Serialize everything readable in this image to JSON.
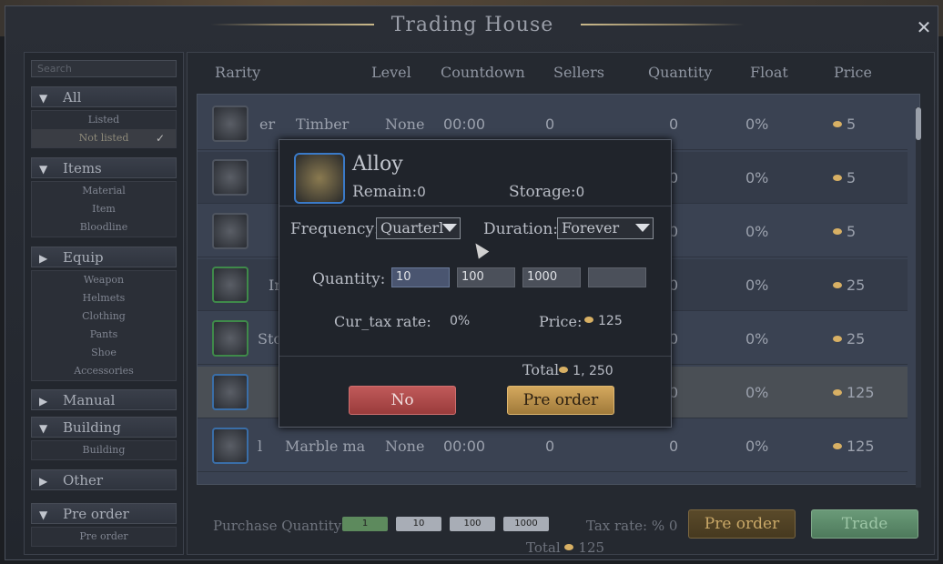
{
  "window": {
    "title": "Trading House"
  },
  "sidebar": {
    "search_placeholder": "Search",
    "categories": [
      {
        "label": "All",
        "sub": [
          "Listed",
          "Not listed"
        ]
      },
      {
        "label": "Items",
        "sub": [
          "Material",
          "Item",
          "Bloodline"
        ]
      },
      {
        "label": "Equip",
        "sub": [
          "Weapon",
          "Helmets",
          "Clothing",
          "Pants",
          "Shoe",
          "Accessories"
        ]
      },
      {
        "label": "Manual",
        "sub": []
      },
      {
        "label": "Building",
        "sub": [
          "Building"
        ]
      },
      {
        "label": "Other",
        "sub": []
      },
      {
        "label": "Pre order",
        "sub": [
          "Pre order"
        ]
      }
    ],
    "selected_sub": "Not listed"
  },
  "table": {
    "headers": [
      "Rarity",
      "Level",
      "Countdown",
      "Sellers",
      "Quantity",
      "Float",
      "Price"
    ],
    "rows": [
      {
        "name_prefix": "er",
        "name": "Timber",
        "level": "None",
        "countdown": "00:00",
        "sellers": "0",
        "quantity": "0",
        "float": "0%",
        "price": "5"
      },
      {
        "name_prefix": "",
        "name": "",
        "level": "",
        "countdown": "",
        "sellers": "",
        "quantity": "0",
        "float": "0%",
        "price": "5"
      },
      {
        "name_prefix": "",
        "name": "",
        "level": "",
        "countdown": "",
        "sellers": "",
        "quantity": "0",
        "float": "0%",
        "price": "5"
      },
      {
        "name_prefix": "Ir",
        "name": "",
        "level": "",
        "countdown": "",
        "sellers": "",
        "quantity": "0",
        "float": "0%",
        "price": "25"
      },
      {
        "name_prefix": "Stor",
        "name": "",
        "level": "",
        "countdown": "",
        "sellers": "",
        "quantity": "0",
        "float": "0%",
        "price": "25"
      },
      {
        "name_prefix": "",
        "name": "",
        "level": "",
        "countdown": "",
        "sellers": "",
        "quantity": "0",
        "float": "0%",
        "price": "125"
      },
      {
        "name_prefix": "l",
        "name": "Marble ma",
        "level": "None",
        "countdown": "00:00",
        "sellers": "0",
        "quantity": "0",
        "float": "0%",
        "price": "125"
      }
    ]
  },
  "bottom": {
    "purchase_quantity_label": "Purchase Quantity",
    "qty_buttons": [
      "1",
      "10",
      "100",
      "1000"
    ],
    "tax_rate": "Tax rate: % 0",
    "total_label": "Total",
    "total_value": "125",
    "preorder_label": "Pre order",
    "trade_label": "Trade"
  },
  "dialog": {
    "item_name": "Alloy",
    "remain_label": "Remain",
    "remain_value": "0",
    "storage_label": "Storage",
    "storage_value": "0",
    "frequency_label": "Frequency:",
    "frequency_value": "Quarterl",
    "duration_label": "Duration:",
    "duration_value": "Forever",
    "quantity_label": "Quantity:",
    "quantity_options": [
      "10",
      "100",
      "1000",
      ""
    ],
    "cur_tax_label": "Cur_tax rate:",
    "cur_tax_value": "0%",
    "price_label": "Price:",
    "price_value": "125",
    "total_label": "Total",
    "total_value": "1, 250",
    "no_label": "No",
    "preorder_label": "Pre order"
  },
  "colors": {
    "no_button": "#b54a4a",
    "preorder_button": "#c39a54",
    "trade_button": "#5d8a6a",
    "qty_active": "#5d8a5d"
  }
}
